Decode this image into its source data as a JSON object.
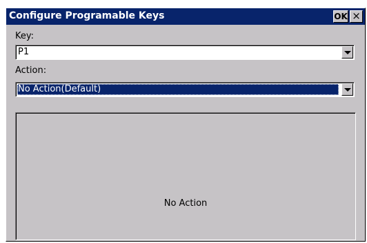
{
  "window": {
    "title": "Configure Programable Keys",
    "ok_label": "OK",
    "close_label": "×"
  },
  "key": {
    "label": "Key:",
    "value": "P1"
  },
  "action": {
    "label": "Action:",
    "value": "No Action(Default)"
  },
  "panel": {
    "text": "No Action"
  },
  "colors": {
    "titlebar": "#08246b",
    "window_face": "#c6c3c6",
    "selection": "#08246b"
  }
}
